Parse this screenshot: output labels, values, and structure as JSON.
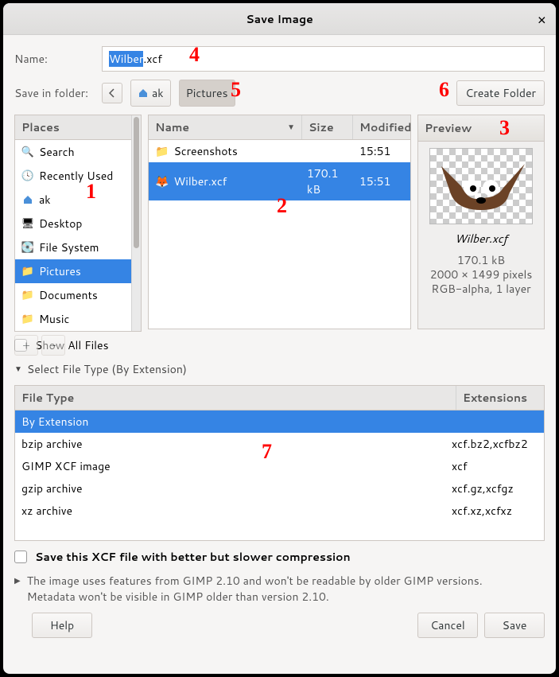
{
  "title": "Save Image",
  "name_label": "Name:",
  "filename_sel": "Wilber",
  "filename_ext": ".xcf",
  "save_in_label": "Save in folder:",
  "path_segments": [
    {
      "label": "ak",
      "icon": "home"
    },
    {
      "label": "Pictures",
      "active": true
    }
  ],
  "create_folder": "Create Folder",
  "places_header": "Places",
  "places": [
    {
      "label": "Search",
      "icon": "search"
    },
    {
      "label": "Recently Used",
      "icon": "recent"
    },
    {
      "label": "ak",
      "icon": "home"
    },
    {
      "label": "Desktop",
      "icon": "desktop"
    },
    {
      "label": "File System",
      "icon": "disk"
    },
    {
      "label": "Pictures",
      "icon": "folder",
      "selected": true
    },
    {
      "label": "Documents",
      "icon": "folder"
    },
    {
      "label": "Music",
      "icon": "folder"
    }
  ],
  "files_headers": {
    "name": "Name",
    "size": "Size",
    "modified": "Modified"
  },
  "files": [
    {
      "name": "Screenshots",
      "size": "",
      "modified": "15:51",
      "icon": "folder"
    },
    {
      "name": "Wilber.xcf",
      "size": "170.1 kB",
      "modified": "15:51",
      "icon": "gimp",
      "selected": true
    }
  ],
  "preview": {
    "header": "Preview",
    "name": "Wilber.xcf",
    "size": "170.1 kB",
    "dims": "2000 × 1499 pixels",
    "mode": "RGB-alpha, 1 layer"
  },
  "show_all": "Show All Files",
  "select_type": "Select File Type (By Extension)",
  "ft_headers": {
    "type": "File Type",
    "ext": "Extensions"
  },
  "file_types": [
    {
      "type": "By Extension",
      "ext": "",
      "selected": true
    },
    {
      "type": "bzip archive",
      "ext": "xcf.bz2,xcfbz2"
    },
    {
      "type": "GIMP XCF image",
      "ext": "xcf"
    },
    {
      "type": "gzip archive",
      "ext": "xcf.gz,xcfgz"
    },
    {
      "type": "xz archive",
      "ext": "xcf.xz,xcfxz"
    }
  ],
  "compression": "Save this XCF file with better but slower compression",
  "note1": "The image uses features from GIMP 2.10 and won't be readable by older GIMP versions.",
  "note2": "Metadata won't be visible in GIMP older than version 2.10.",
  "buttons": {
    "help": "Help",
    "cancel": "Cancel",
    "save": "Save"
  },
  "annotations": {
    "a1": "1",
    "a2": "2",
    "a3": "3",
    "a4": "4",
    "a5": "5",
    "a6": "6",
    "a7": "7"
  }
}
